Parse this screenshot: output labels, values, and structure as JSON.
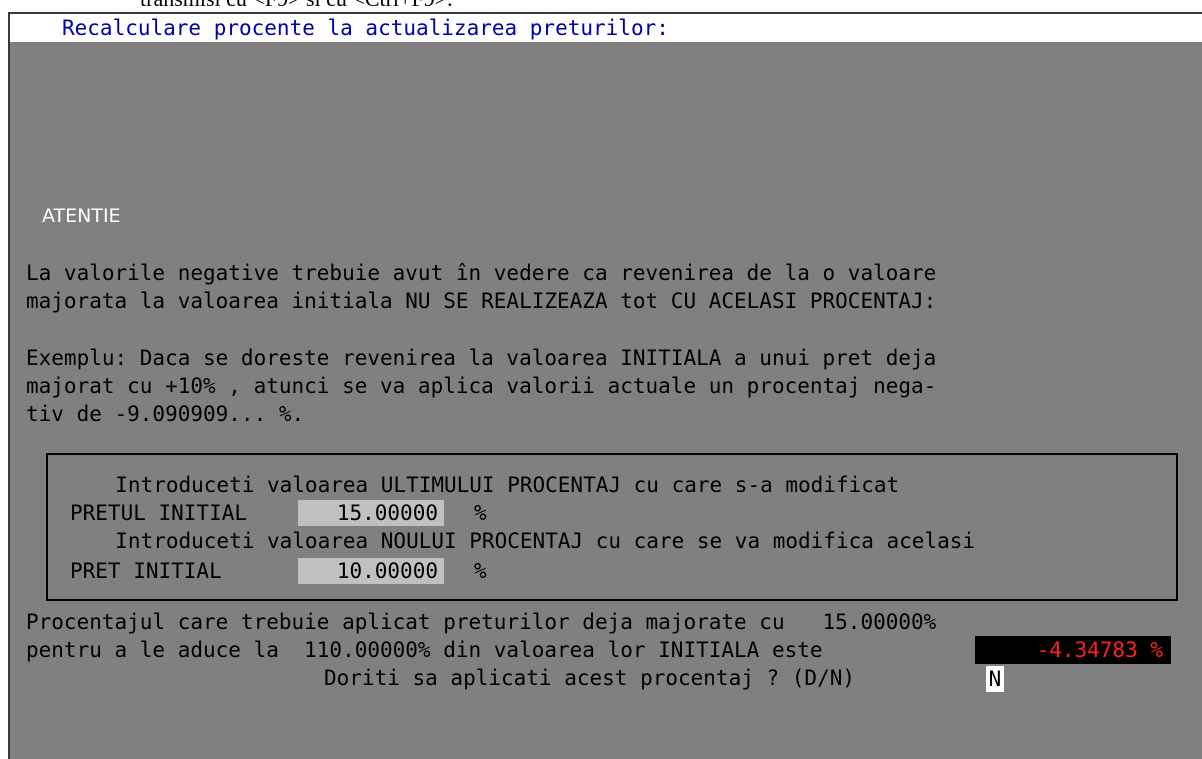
{
  "top_strip": {
    "text": "transmisi cu <F9> si cu <Ctrl+F9>."
  },
  "title": "Recalculare procente la actualizarea preturilor:",
  "warning": {
    "heading": "ATENTIE",
    "paragraph1": [
      "La valorile negative trebuie avut în vedere ca revenirea de la o valoare",
      "majorata la valoarea initiala NU SE REALIZEAZA tot CU ACELASI PROCENTAJ:"
    ],
    "paragraph2": [
      "Exemplu: Daca se doreste revenirea la valoarea INITIALA a unui pret deja",
      "majorat cu +10% , atunci se va aplica valorii actuale un procentaj nega-",
      "tiv de -9.090909... %."
    ]
  },
  "form": {
    "line1": "  Introduceti valoarea ULTIMULUI PROCENTAJ cu care s-a modificat",
    "label1": "PRETUL INITIAL",
    "value1": "15.00000",
    "unit1": "%",
    "line2": "  Introduceti valoarea NOULUI PROCENTAJ cu care se va modifica acelasi",
    "label2": "PRET INITIAL",
    "value2": "10.00000",
    "unit2": "%"
  },
  "result": {
    "line1": "Procentajul care trebuie aplicat preturilor deja majorate cu   15.00000%",
    "line2": "pentru a le aduce la  110.00000% din valoarea lor INITIALA este",
    "value": "-4.34783 %",
    "question": "Doriti sa aplicati acest procentaj ? (D/N)",
    "answer": "N"
  }
}
